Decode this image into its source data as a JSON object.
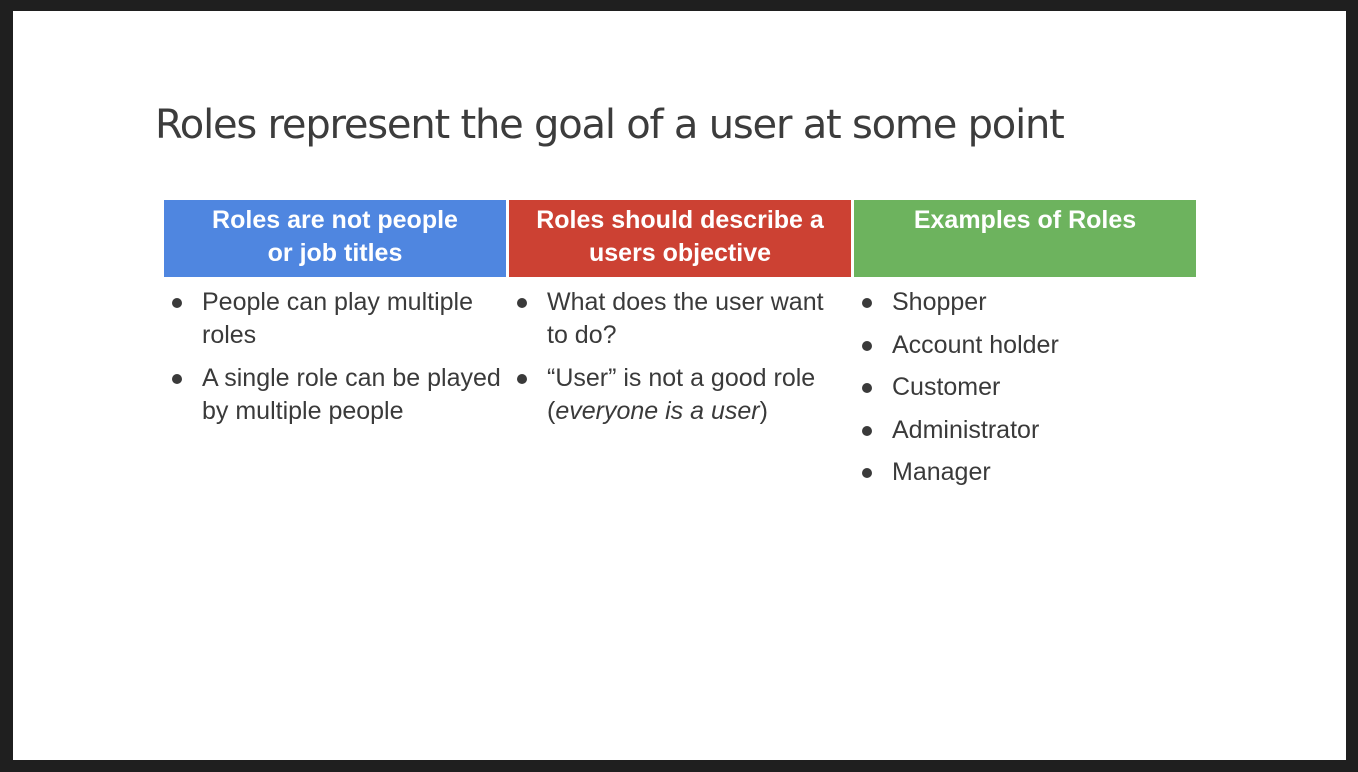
{
  "slide": {
    "title": "Roles represent the goal of a user at some point",
    "columns": [
      {
        "heading_line1": "Roles are not people",
        "heading_line2": "or job titles",
        "color": "#4f86e0",
        "items": [
          "People can play multiple roles",
          "A single role can be played by multiple people"
        ]
      },
      {
        "heading_line1": "Roles should describe a",
        "heading_line2": "users objective",
        "color": "#cc4133",
        "items": [
          "What does the user want to do?"
        ],
        "item2_main": "“User” is not a good role (",
        "item2_italic": "everyone is a user",
        "item2_end": ")"
      },
      {
        "heading_line1": "Examples of Roles",
        "color": "#6db35e",
        "items": [
          "Shopper",
          "Account holder",
          "Customer",
          "Administrator",
          "Manager"
        ]
      }
    ]
  }
}
